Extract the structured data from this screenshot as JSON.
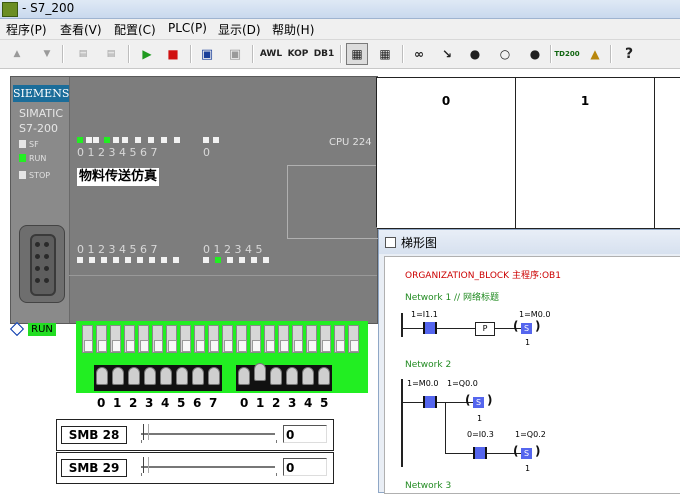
{
  "window": {
    "title": "- S7_200"
  },
  "menu": [
    {
      "key": "program",
      "label": "程序(P)"
    },
    {
      "key": "view",
      "label": "查看(V)"
    },
    {
      "key": "config",
      "label": "配置(C)"
    },
    {
      "key": "plc",
      "label": "PLC(P)"
    },
    {
      "key": "display",
      "label": "显示(D)"
    },
    {
      "key": "help",
      "label": "帮助(H)"
    }
  ],
  "toolbar": {
    "awl": "AWL",
    "kop": "KOP",
    "db1": "DB1",
    "td200": "TD200",
    "help": "?"
  },
  "plc": {
    "brand": "SIEMENS",
    "model_line1": "SIMATIC",
    "model_line2": "S7-200",
    "led_sf": "SF",
    "led_run": "RUN",
    "led_stop": "STOP",
    "cpu": "CPU 224",
    "caption": "物料传送仿真",
    "top_digits_a": "0 1 2 3 4 5 6 7",
    "top_digits_b": "0",
    "bottom_digits_a": "0 1 2 3 4 5 6 7",
    "bottom_digits_b": "0 1 2 3 4 5",
    "run_indicator": "RUN"
  },
  "switch_numbers": [
    "0",
    "1",
    "2",
    "3",
    "4",
    "5",
    "6",
    "7",
    "0",
    "1",
    "2",
    "3",
    "4",
    "5"
  ],
  "smb": [
    {
      "label": "SMB 28",
      "value": "0"
    },
    {
      "label": "SMB 29",
      "value": "0"
    }
  ],
  "status_chart": {
    "columns": [
      "0",
      "1"
    ]
  },
  "ladder": {
    "title": "梯形图",
    "org_block": "ORGANIZATION_BLOCK 主程序:OB1",
    "network1": {
      "title": "Network 1 // 网络标题",
      "contact_label": "1=I1.1",
      "coil_label": "1=M0.0",
      "p_label": "P",
      "coil_text": "S",
      "count": "1"
    },
    "network2": {
      "title": "Network 2",
      "contact_label": "1=M0.0",
      "coil_label": "1=Q0.0",
      "coil_text": "S",
      "count": "1",
      "contact2_label": "0=I0.3",
      "coil2_label": "1=Q0.2",
      "coil2_text": "S",
      "count2": "1"
    },
    "network3": {
      "title": "Network 3"
    }
  }
}
